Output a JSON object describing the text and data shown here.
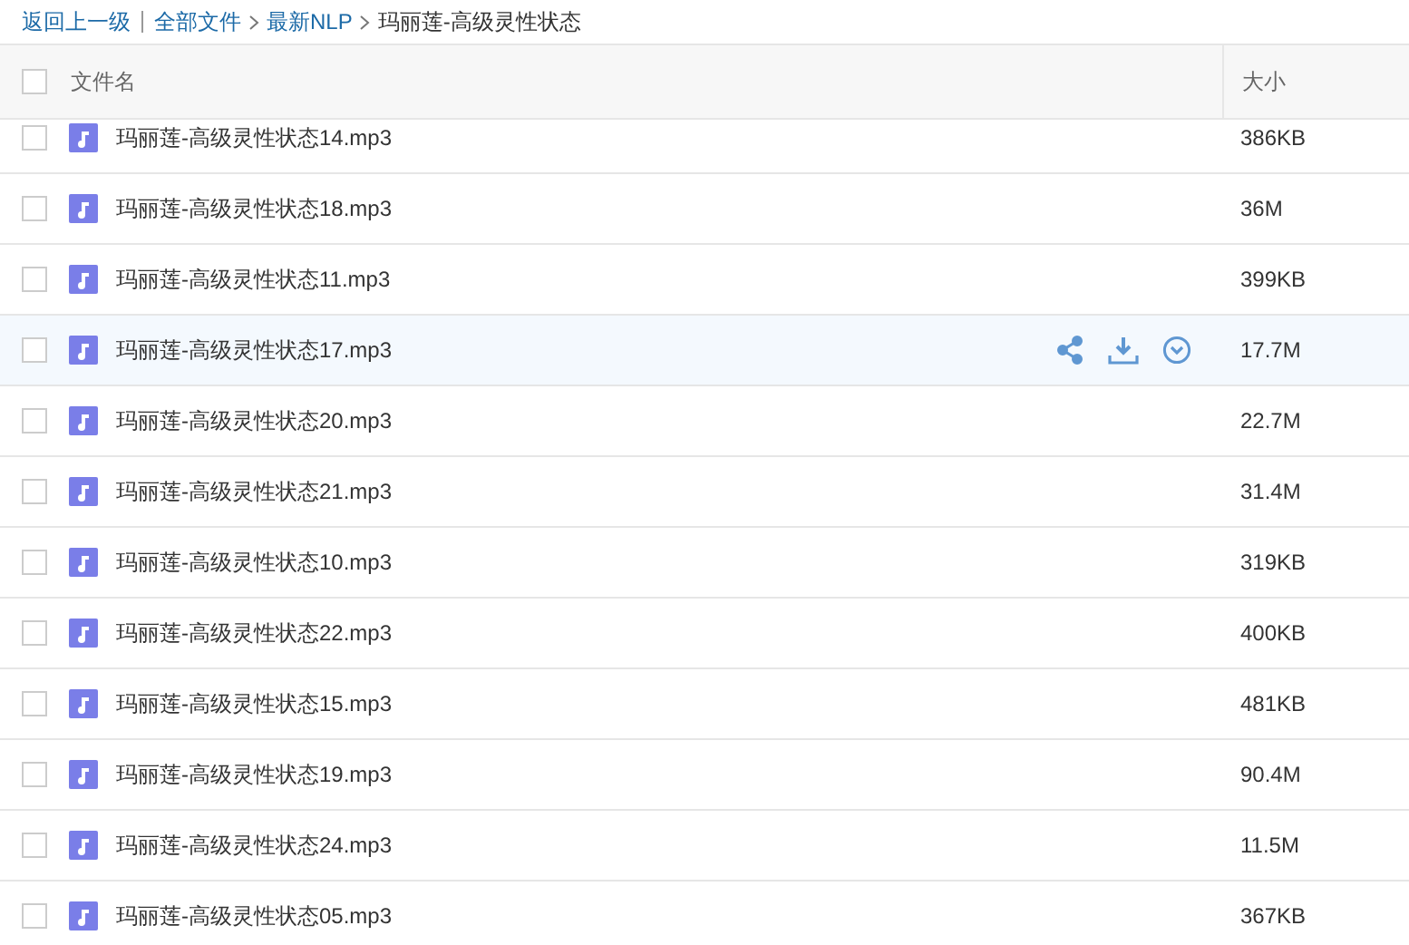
{
  "breadcrumb": [
    {
      "label": "返回上一级",
      "link": true
    },
    {
      "label": "全部文件",
      "link": true
    },
    {
      "label": "最新NLP",
      "link": true
    },
    {
      "label": "玛丽莲-高级灵性状态",
      "link": false
    }
  ],
  "header": {
    "checked": false,
    "name": "文件名",
    "size": "大小"
  },
  "rows": [
    {
      "name": "玛丽莲-高级灵性状态14.mp3",
      "size": "386KB",
      "checked": false,
      "hovered": false
    },
    {
      "name": "玛丽莲-高级灵性状态18.mp3",
      "size": "36M",
      "checked": false,
      "hovered": false
    },
    {
      "name": "玛丽莲-高级灵性状态11.mp3",
      "size": "399KB",
      "checked": false,
      "hovered": false
    },
    {
      "name": "玛丽莲-高级灵性状态17.mp3",
      "size": "17.7M",
      "checked": false,
      "hovered": true
    },
    {
      "name": "玛丽莲-高级灵性状态20.mp3",
      "size": "22.7M",
      "checked": false,
      "hovered": false
    },
    {
      "name": "玛丽莲-高级灵性状态21.mp3",
      "size": "31.4M",
      "checked": false,
      "hovered": false
    },
    {
      "name": "玛丽莲-高级灵性状态10.mp3",
      "size": "319KB",
      "checked": false,
      "hovered": false
    },
    {
      "name": "玛丽莲-高级灵性状态22.mp3",
      "size": "400KB",
      "checked": false,
      "hovered": false
    },
    {
      "name": "玛丽莲-高级灵性状态15.mp3",
      "size": "481KB",
      "checked": false,
      "hovered": false
    },
    {
      "name": "玛丽莲-高级灵性状态19.mp3",
      "size": "90.4M",
      "checked": false,
      "hovered": false
    },
    {
      "name": "玛丽莲-高级灵性状态24.mp3",
      "size": "11.5M",
      "checked": false,
      "hovered": false
    },
    {
      "name": "玛丽莲-高级灵性状态05.mp3",
      "size": "367KB",
      "checked": false,
      "hovered": false
    }
  ]
}
